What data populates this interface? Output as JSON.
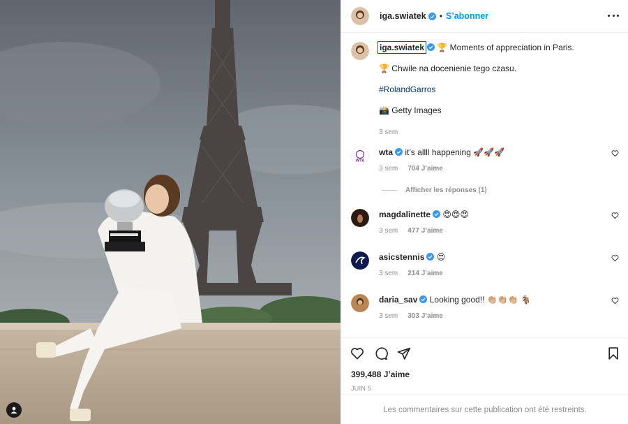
{
  "post": {
    "author": "iga.swiatek",
    "separator": "•",
    "follow_label": "S’abonner",
    "more_icon": "more-options-icon"
  },
  "caption": {
    "username": "iga.swiatek",
    "line1": "🏆 Moments of appreciation in Paris.",
    "line2": "🏆 Chwile na docenienie tego czasu.",
    "hashtag": "#RolandGarros",
    "credit": "📸 Getty Images",
    "time": "3 sem"
  },
  "comments": [
    {
      "user": "wta",
      "text": "it’s allll happening 🚀🚀🚀",
      "time": "3 sem",
      "likes": "704 J’aime",
      "avatar_color": "#7b2ea8"
    },
    {
      "user": "magdalinette",
      "text": "😍😍😍",
      "time": "3 sem",
      "likes": "477 J’aime",
      "avatar_color": "#3a2418"
    },
    {
      "user": "asicstennis",
      "text": "😍",
      "time": "3 sem",
      "likes": "214 J’aime",
      "avatar_color": "#0f1b4c"
    },
    {
      "user": "daria_sav",
      "text": "Looking good!! 👏🏼👏🏼👏🏼 🐐",
      "time": "3 sem",
      "likes": "303 J’aime",
      "avatar_color": "#c98a4a"
    }
  ],
  "replies_label": "Afficher les réponses (1)",
  "footer": {
    "likes": "399,488 J’aime",
    "date": "JUIN 5",
    "restricted": "Les commentaires sur cette publication ont été restreints."
  }
}
